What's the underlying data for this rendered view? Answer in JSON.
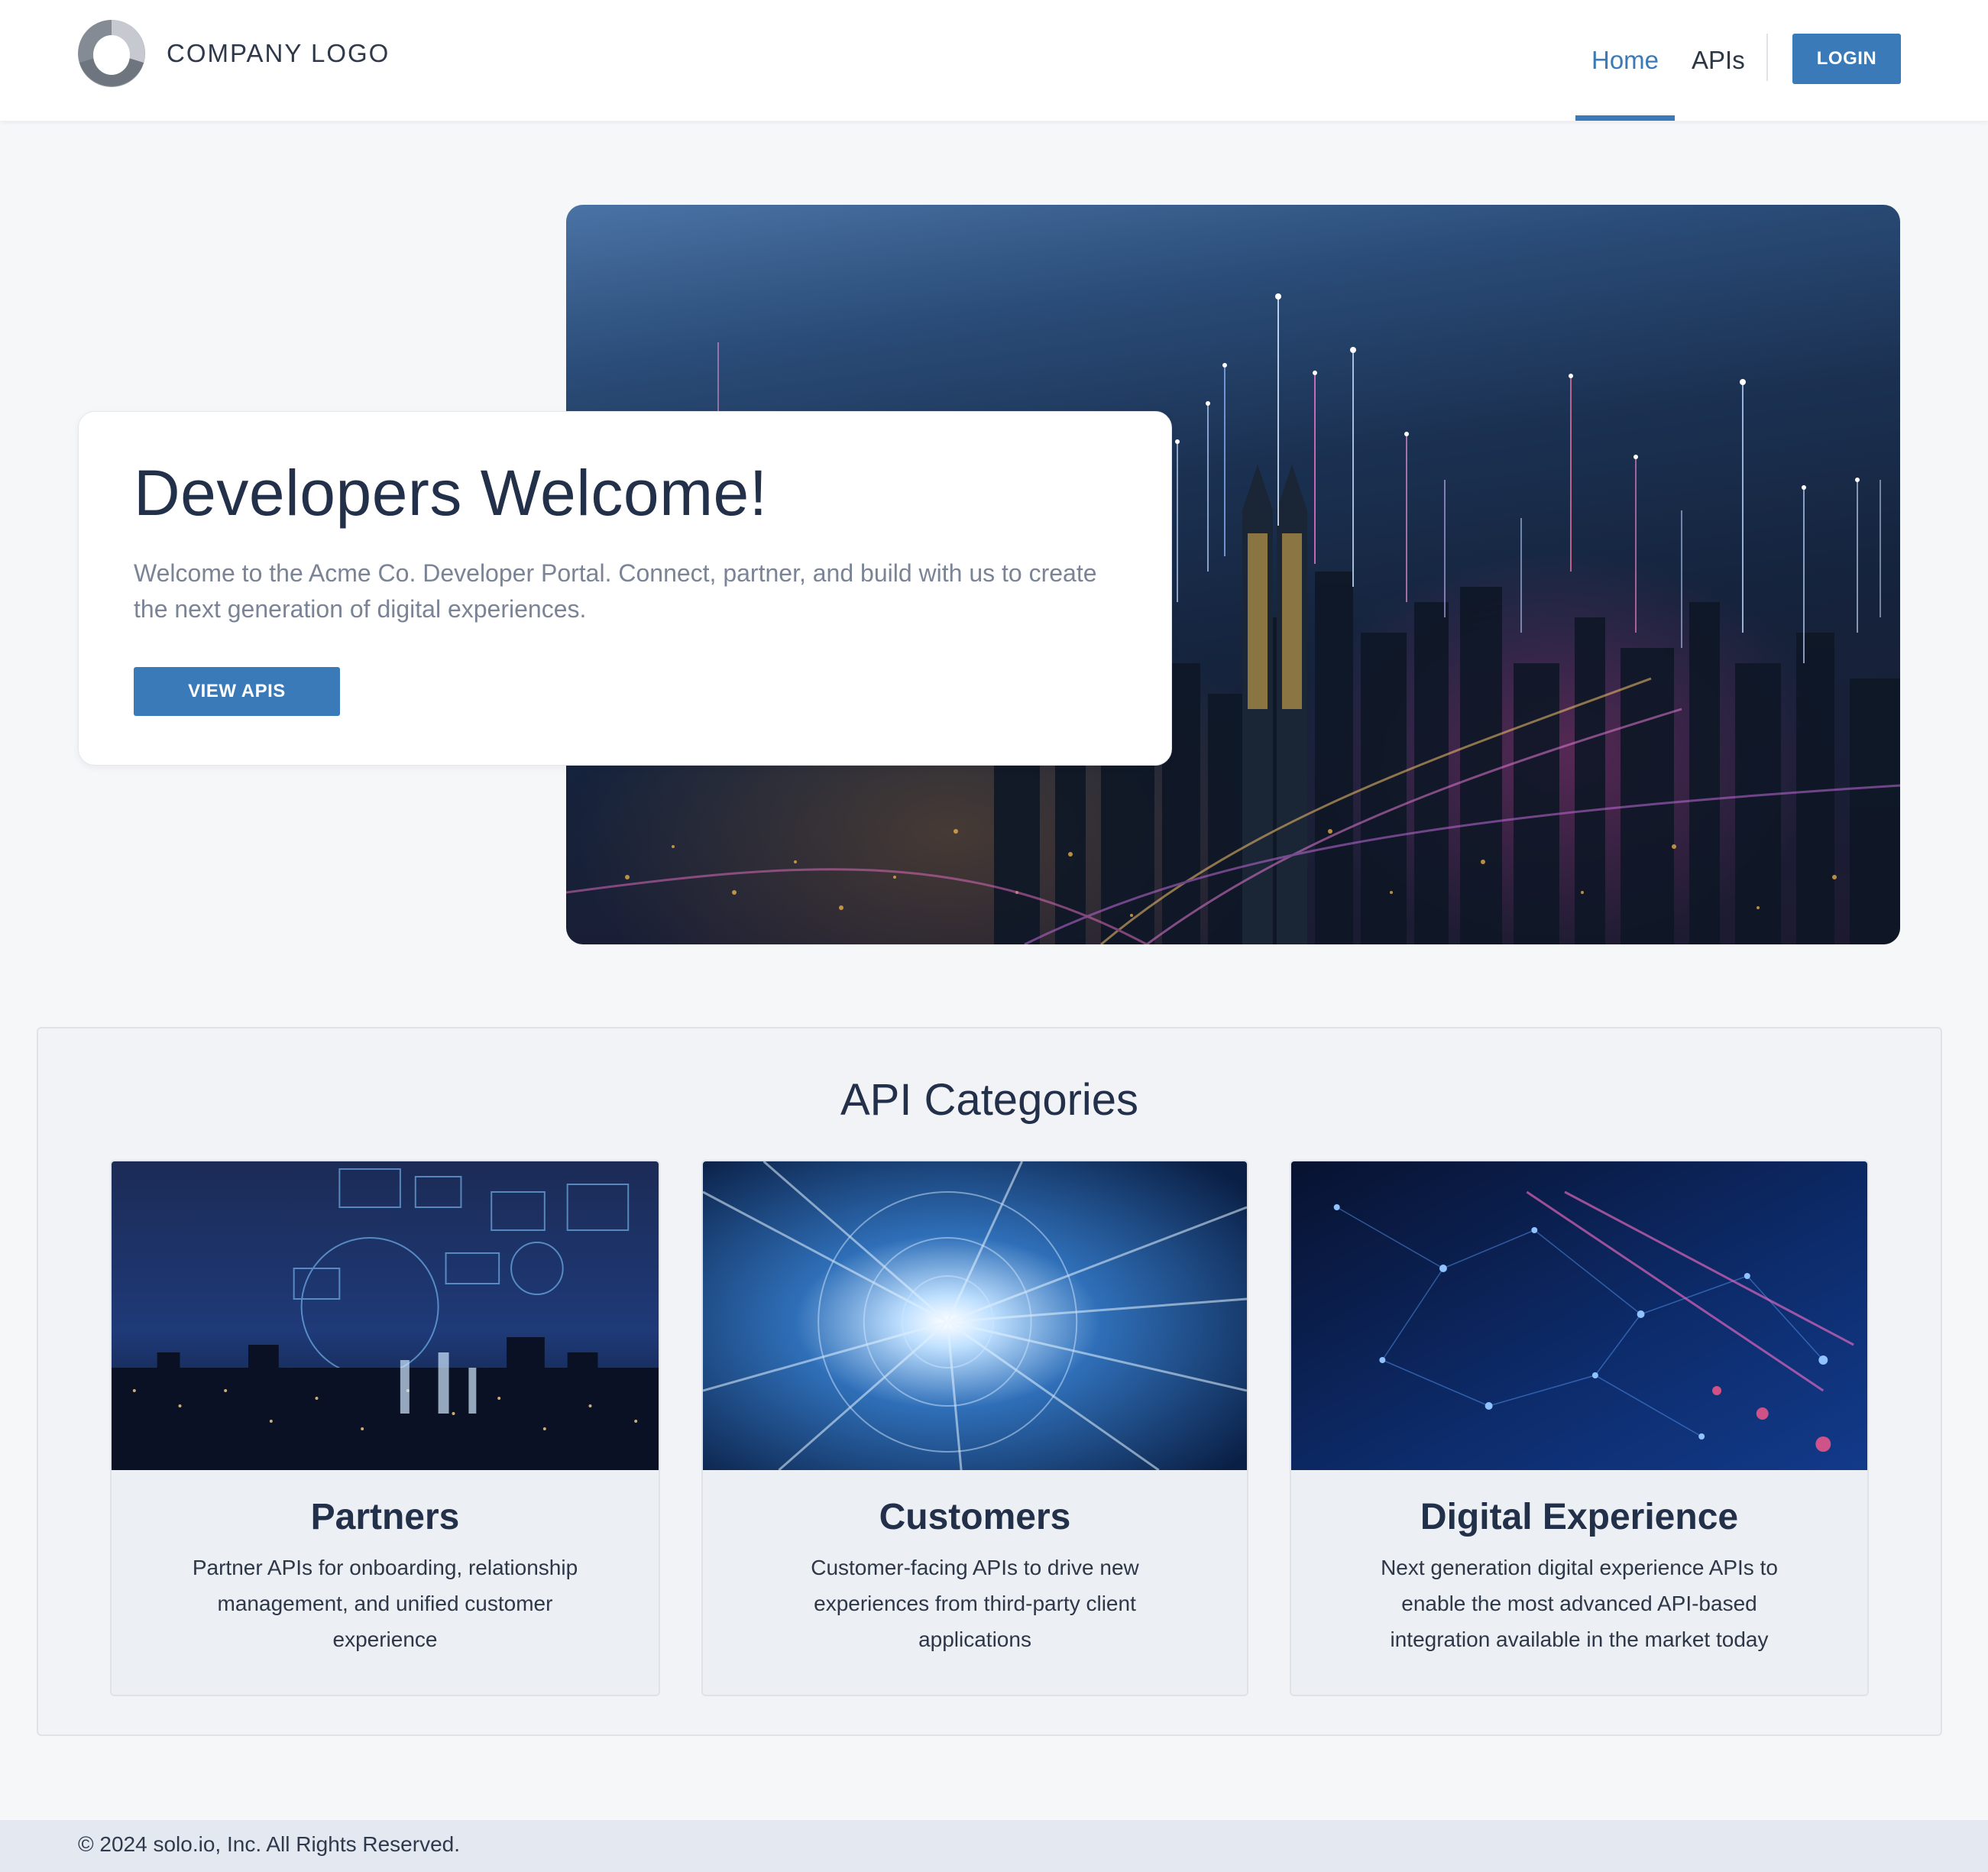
{
  "header": {
    "logo_text": "COMPANY LOGO",
    "nav": {
      "home": "Home",
      "apis": "APIs"
    },
    "login_label": "LOGIN"
  },
  "hero": {
    "title": "Developers Welcome!",
    "description": "Welcome to the Acme Co. Developer Portal. Connect, partner, and build with us to create the next generation of digital experiences.",
    "cta_label": "VIEW APIS"
  },
  "categories": {
    "title": "API Categories",
    "items": [
      {
        "title": "Partners",
        "description": "Partner APIs for onboarding, relationship management, and unified customer experience"
      },
      {
        "title": "Customers",
        "description": "Customer-facing APIs to drive new experiences from third-party client applications"
      },
      {
        "title": "Digital Experience",
        "description": "Next generation digital experience APIs to enable the most advanced API-based integration available in the market today"
      }
    ]
  },
  "footer": {
    "copyright": "© 2024 solo.io, Inc. All Rights Reserved."
  },
  "colors": {
    "accent": "#3a7ab8",
    "heading": "#23304a",
    "background": "#f6f7f9",
    "footer": "#e3e8f1"
  },
  "icons": [
    "company-logo-mark"
  ]
}
